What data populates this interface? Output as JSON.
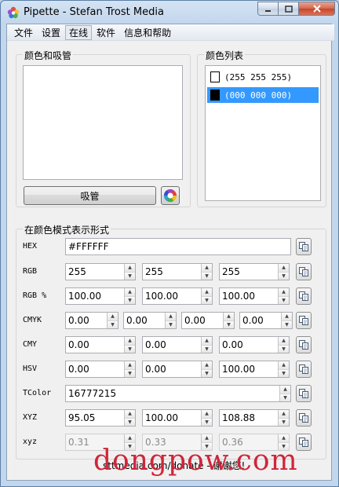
{
  "window": {
    "title": "Pipette - Stefan Trost Media"
  },
  "menu": [
    "文件",
    "设置",
    "在线",
    "软件",
    "信息和帮助"
  ],
  "picker": {
    "group_title": "颜色和吸管",
    "pick_button": "吸管"
  },
  "color_list": {
    "group_title": "颜色列表",
    "items": [
      {
        "label": "(255 255 255)",
        "swatch": "#ffffff",
        "selected": false
      },
      {
        "label": "(000 000 000)",
        "swatch": "#000000",
        "selected": true
      }
    ]
  },
  "formats": {
    "group_title": "在颜色模式表示形式",
    "rows": [
      {
        "label": "HEX",
        "fields": [
          "#FFFFFF"
        ],
        "spin": false,
        "disabled": false
      },
      {
        "label": "RGB",
        "fields": [
          "255",
          "255",
          "255"
        ],
        "spin": true,
        "disabled": false
      },
      {
        "label": "RGB %",
        "fields": [
          "100.00",
          "100.00",
          "100.00"
        ],
        "spin": true,
        "disabled": false
      },
      {
        "label": "CMYK",
        "fields": [
          "0.00",
          "0.00",
          "0.00",
          "0.00"
        ],
        "spin": true,
        "disabled": false
      },
      {
        "label": "CMY",
        "fields": [
          "0.00",
          "0.00",
          "0.00"
        ],
        "spin": true,
        "disabled": false
      },
      {
        "label": "HSV",
        "fields": [
          "0.00",
          "0.00",
          "100.00"
        ],
        "spin": true,
        "disabled": false
      },
      {
        "label": "TColor",
        "fields": [
          "16777215"
        ],
        "spin": true,
        "disabled": false
      },
      {
        "label": "XYZ",
        "fields": [
          "95.05",
          "100.00",
          "108.88"
        ],
        "spin": true,
        "disabled": false
      },
      {
        "label": "xyz",
        "fields": [
          "0.31",
          "0.33",
          "0.36"
        ],
        "spin": true,
        "disabled": true
      }
    ]
  },
  "footer": {
    "donate_text": "sttmedia.com/donate - 谢谢您!"
  },
  "watermark": {
    "text": "dongpow.com"
  },
  "colors": {
    "selection": "#3399ff",
    "watermark": "#d0253a"
  }
}
